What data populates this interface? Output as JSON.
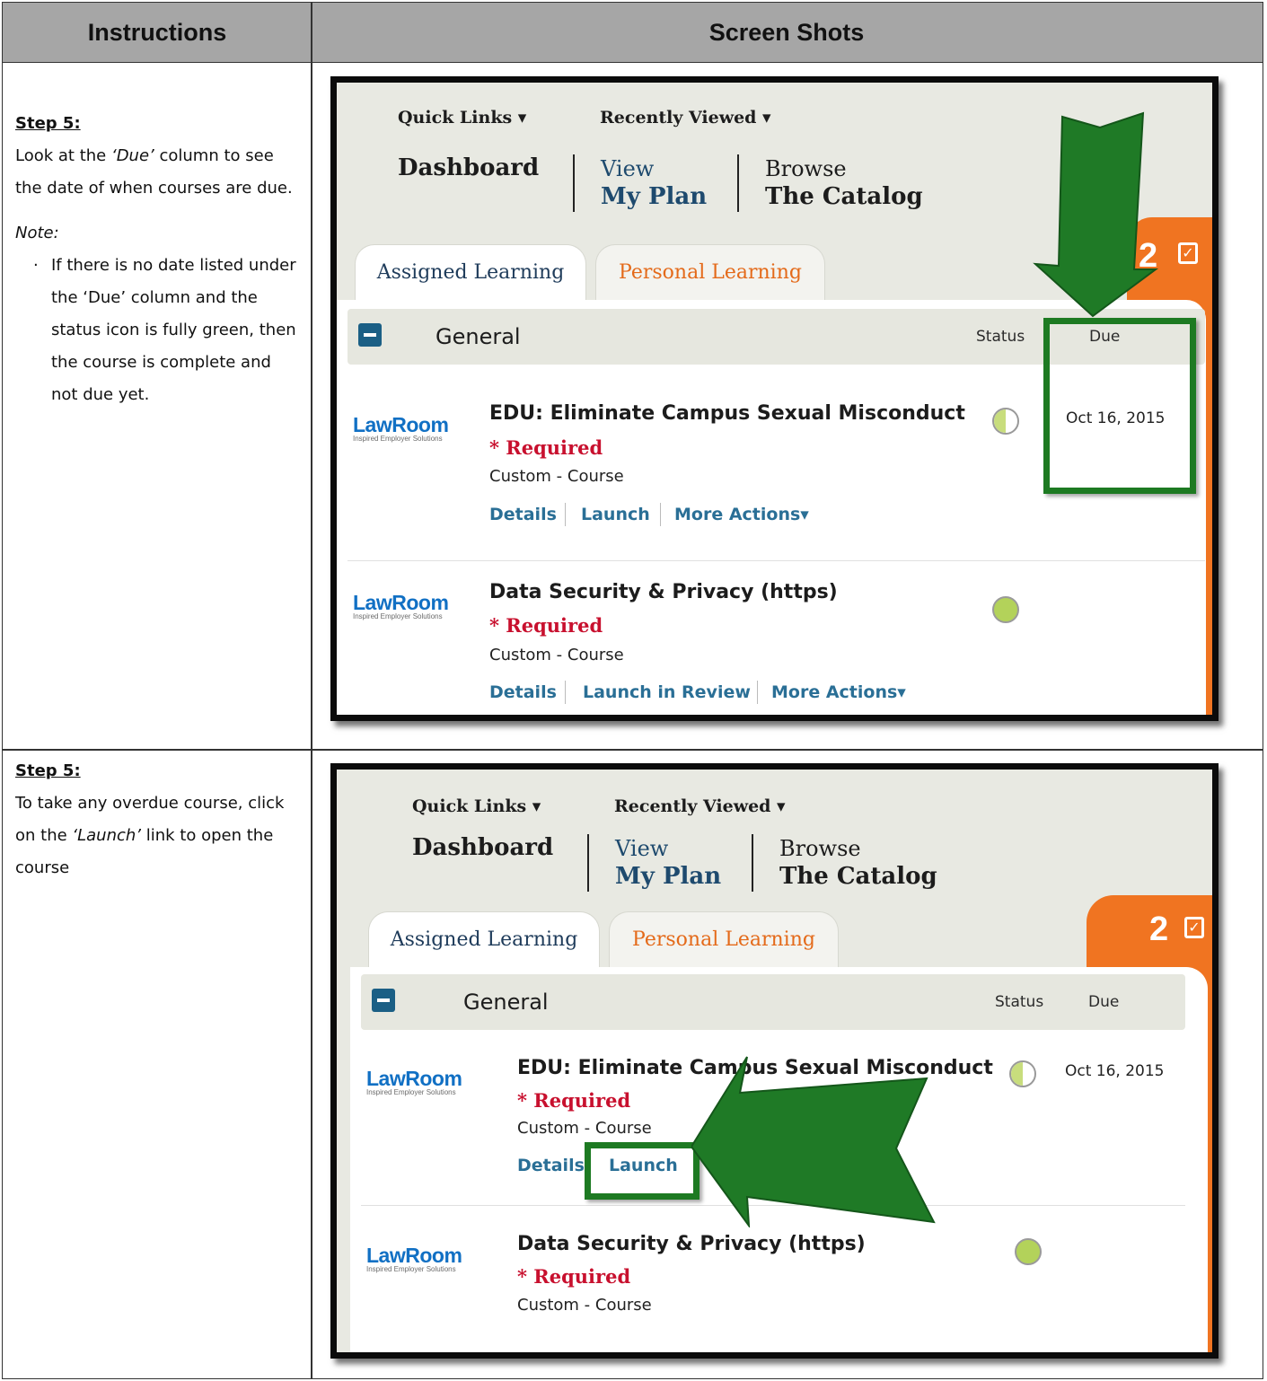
{
  "header": {
    "instructions": "Instructions",
    "screenshots": "Screen Shots"
  },
  "rows": [
    {
      "step": "Step 5:",
      "text": "Look at the ‘Due’ column to see the date of when courses are due.",
      "text_parts": [
        "Look at the ",
        "‘Due’",
        " column to see the date of when courses are due."
      ],
      "note": "Note:",
      "bullets": [
        "If there is no date listed under the ‘Due’ column and the status icon is fully green, then the course is complete and not due yet."
      ]
    },
    {
      "step": "Step 5:",
      "text_parts": [
        "To take any overdue course, click on the ",
        "‘Launch’",
        " link to open the course"
      ]
    }
  ],
  "app": {
    "quick_links": "Quick Links ▾",
    "recently_viewed": "Recently Viewed ▾",
    "dashboard": "Dashboard",
    "view": "View",
    "my_plan": "My Plan",
    "browse": "Browse",
    "the_catalog": "The Catalog",
    "badge_count": "2",
    "tab_assigned": "Assigned Learning",
    "tab_personal": "Personal Learning",
    "group_title": "General",
    "col_status": "Status",
    "col_due": "Due",
    "logo_name": "LawRoom",
    "logo_tagline": "Inspired Employer Solutions",
    "courses": [
      {
        "title": "EDU: Eliminate Campus Sexual Misconduct",
        "required": "* Required",
        "type": "Custom - Course",
        "due": "Oct 16, 2015",
        "links": [
          "Details",
          "Launch",
          "More Actions▾"
        ]
      },
      {
        "title": "Data Security & Privacy (https)",
        "required": "* Required",
        "type": "Custom - Course",
        "due": "",
        "links": [
          "Details",
          "Launch in Review",
          "More Actions▾"
        ]
      }
    ]
  },
  "colors": {
    "accent_orange": "#f07421",
    "highlight_green": "#1d7a22",
    "link_blue": "#2a6f96",
    "required_red": "#c8102e",
    "header_gray": "#a6a6a6"
  }
}
